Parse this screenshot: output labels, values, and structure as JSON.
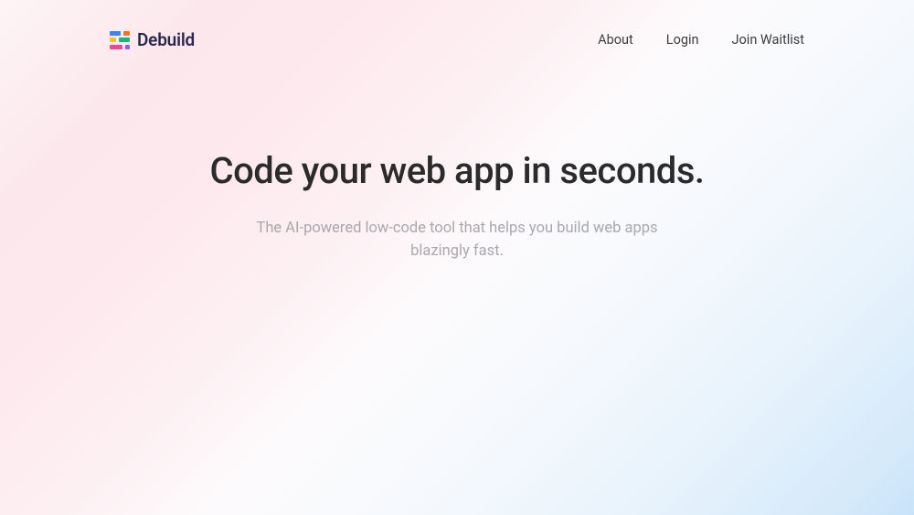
{
  "brand": {
    "name": "Debuild"
  },
  "nav": {
    "about": "About",
    "login": "Login",
    "join": "Join Waitlist"
  },
  "hero": {
    "title": "Code your web app in seconds.",
    "subtitle": "The AI-powered low-code tool that helps you build web apps blazingly fast."
  }
}
